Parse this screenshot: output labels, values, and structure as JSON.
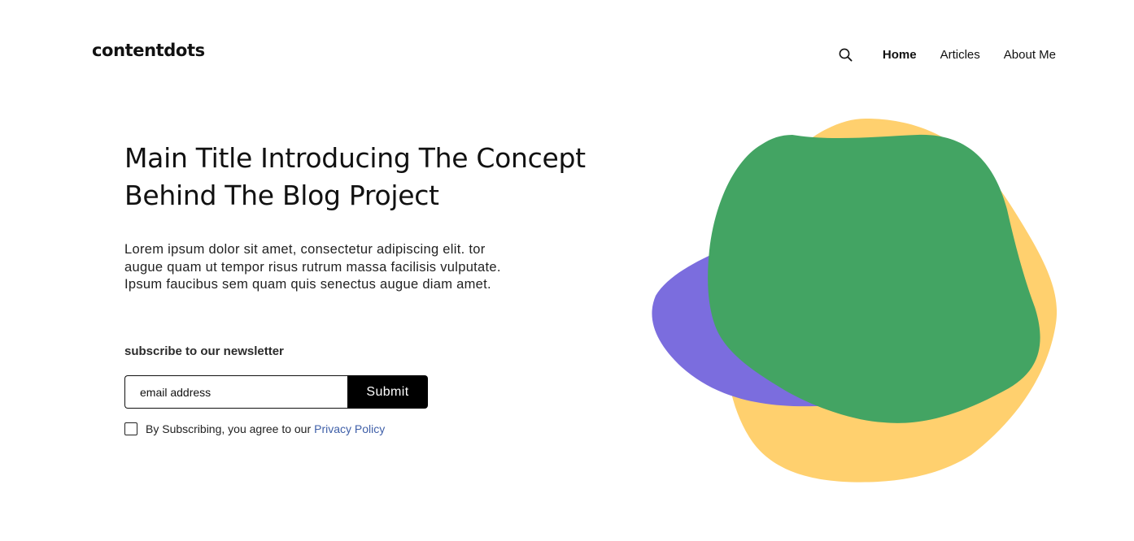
{
  "header": {
    "logo": "contentdots",
    "nav": [
      {
        "label": "Home",
        "active": true
      },
      {
        "label": "Articles",
        "active": false
      },
      {
        "label": "About Me",
        "active": false
      }
    ],
    "search_icon": "search-icon"
  },
  "hero": {
    "title": "Main Title Introducing The Concept Behind The Blog Project",
    "body": "Lorem ipsum dolor sit amet, consectetur adipiscing elit. tor augue quam ut tempor risus rutrum massa facilisis vulputate. Ipsum faucibus sem quam quis senectus augue diam amet."
  },
  "newsletter": {
    "heading": "subscribe to our newsletter",
    "email_placeholder": "email address",
    "submit_label": "Submit",
    "consent_text": "By Subscribing, you agree to our",
    "policy_link": "Privacy Policy"
  },
  "colors": {
    "blob_yellow": "#FFD06E",
    "blob_purple": "#7B6DDE",
    "blob_green": "#43A463",
    "link": "#3F5FA8",
    "button": "#000000"
  }
}
